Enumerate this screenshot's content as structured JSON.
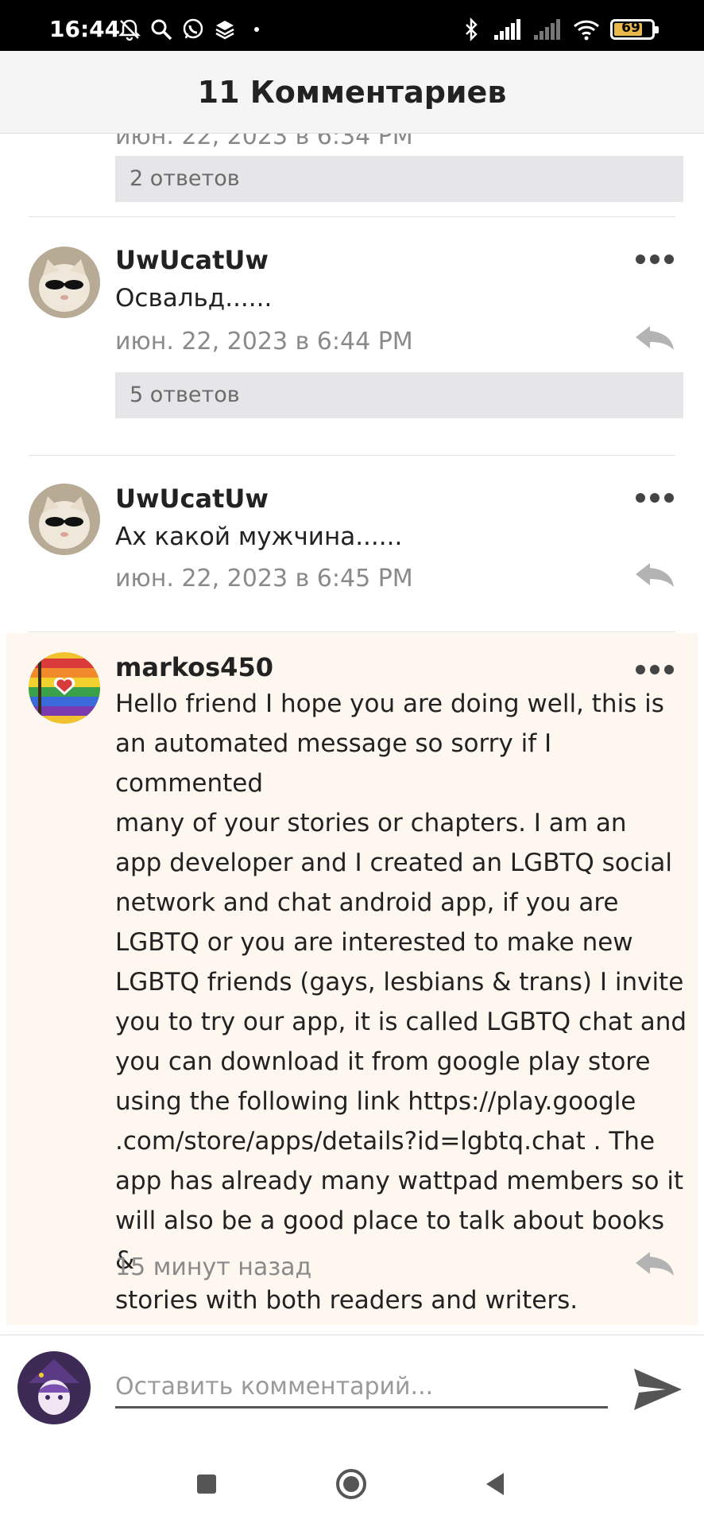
{
  "status_bar": {
    "time": "16:44",
    "battery": "69",
    "left_icons": [
      "bell-off-icon",
      "search-icon",
      "whatsapp-icon",
      "layers-icon",
      "dot-icon"
    ],
    "right_icons": [
      "bluetooth-icon",
      "signal-icon",
      "signal-weak-icon",
      "wifi-icon"
    ]
  },
  "header": {
    "title": "11 Комментариев"
  },
  "partial": {
    "date": "июн. 22, 2023 в 6:34 PM",
    "replies": "2 ответов"
  },
  "comments": [
    {
      "username": "UwUcatUw",
      "text": "Освальд......",
      "date": "июн. 22, 2023 в 6:44 PM",
      "replies": "5 ответов"
    },
    {
      "username": "UwUcatUw",
      "text": "Ах какой мужчина......",
      "date": "июн. 22, 2023 в 6:45 PM"
    },
    {
      "username": "markos450",
      "text_lines": [
        "Hello friend I hope you are doing well, this is",
        "an automated message so sorry if I commented",
        "many of your stories or chapters. I am an",
        "app developer and I created an LGBTQ social",
        "network and chat android app, if you are",
        "LGBTQ or you are interested to make new",
        "LGBTQ friends (gays, lesbians & trans) I invite",
        "you to try our app, it is called LGBTQ chat and",
        "you can download it from google play store",
        "using the following link https://play.google",
        ".com/store/apps/details?id=lgbtq.chat . The",
        "app has already many wattpad members so it",
        "will also be a good place to talk about books &",
        "stories with both readers and writers."
      ],
      "date": "15 минут назад"
    }
  ],
  "compose": {
    "placeholder": "Оставить комментарий..."
  },
  "colors": {
    "highlight_bg": "#fdf7ef",
    "replies_bg": "#e6e6e8",
    "header_bg": "#f5f5f5"
  }
}
